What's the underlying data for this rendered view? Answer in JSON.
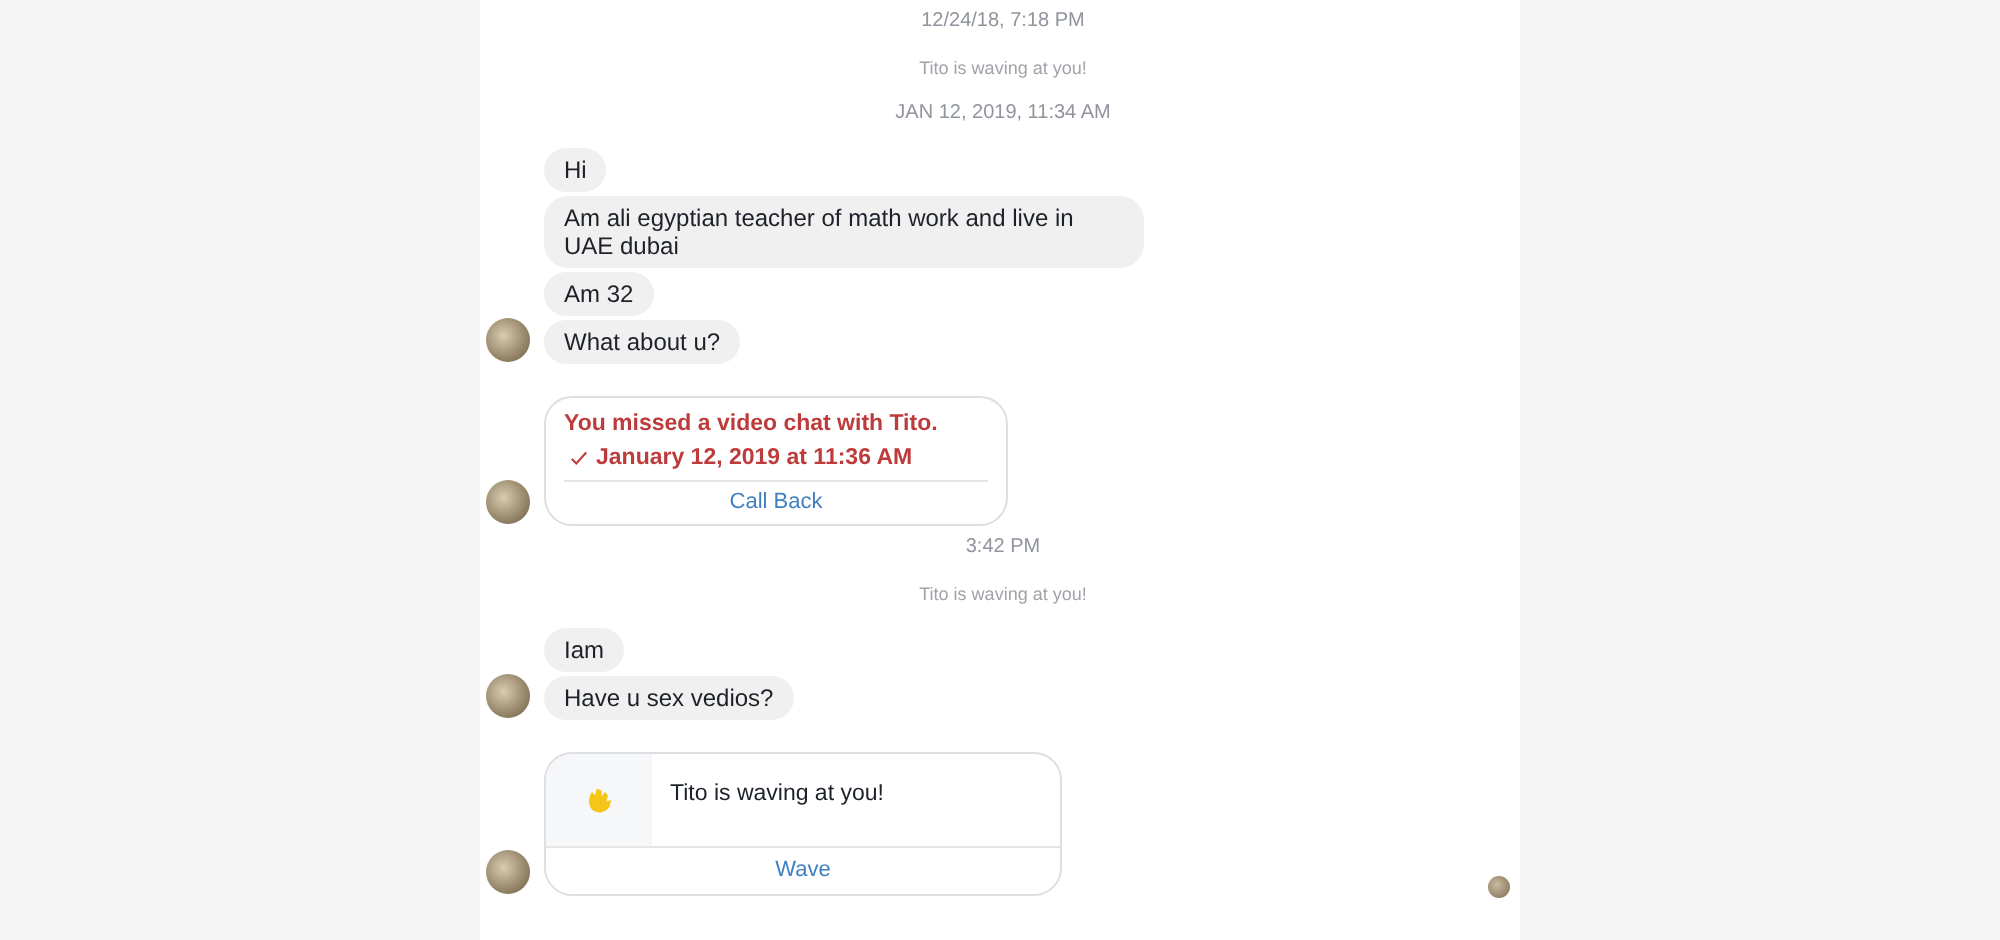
{
  "items": [
    {
      "kind": "time",
      "text": "12/24/18, 7:18 PM"
    },
    {
      "kind": "notice",
      "text": "Tito is waving at you!"
    },
    {
      "kind": "time",
      "text": "JAN 12, 2019, 11:34 AM"
    },
    {
      "kind": "messages",
      "messages": [
        "Hi",
        "Am ali egyptian teacher of math work and live in UAE dubai",
        "Am 32",
        "What about u?"
      ]
    },
    {
      "kind": "missed_call",
      "title": "You missed a video chat with Tito.",
      "time": "January 12, 2019 at 11:36 AM",
      "action": "Call Back"
    },
    {
      "kind": "time",
      "text": "3:42 PM"
    },
    {
      "kind": "notice",
      "text": "Tito is waving at you!"
    },
    {
      "kind": "messages",
      "messages": [
        "Iam",
        "Have u sex vedios?"
      ]
    },
    {
      "kind": "wave",
      "text": "Tito is waving at you!",
      "action": "Wave"
    }
  ],
  "seen": true
}
